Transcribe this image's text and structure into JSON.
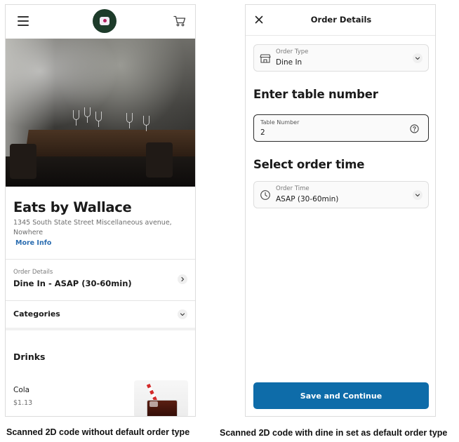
{
  "left_screen": {
    "restaurant": {
      "name": "Eats by Wallace",
      "address": "1345 South State Street Miscellaneous avenue, Nowhere",
      "more_info": "More Info"
    },
    "order_details": {
      "label": "Order Details",
      "value": "Dine In - ASAP (30-60min)"
    },
    "categories_label": "Categories",
    "section_heading": "Drinks",
    "items": [
      {
        "name": "Cola",
        "price": "$1.13"
      }
    ],
    "icons": {
      "menu": "hamburger-menu-icon",
      "logo": "restaurant-logo",
      "cart": "shopping-cart-icon",
      "order_chevron": "chevron-right-icon",
      "categories_chevron": "chevron-down-icon"
    }
  },
  "right_screen": {
    "header": {
      "title": "Order Details",
      "close_icon": "close-icon"
    },
    "order_type": {
      "label": "Order Type",
      "value": "Dine In",
      "icon": "store-icon"
    },
    "table_heading": "Enter table number",
    "table_field": {
      "label": "Table Number",
      "value": "2",
      "icon": "help-icon"
    },
    "time_heading": "Select order time",
    "order_time": {
      "label": "Order Time",
      "value": "ASAP (30-60min)",
      "icon": "clock-icon"
    },
    "save_button": "Save and Continue"
  },
  "captions": {
    "left": "Scanned 2D code without default order type",
    "right": "Scanned 2D code with dine in set as default order type"
  },
  "colors": {
    "primary_button": "#0e6ca9",
    "link": "#2a6cb0",
    "logo_bg": "#1d3b2a"
  }
}
